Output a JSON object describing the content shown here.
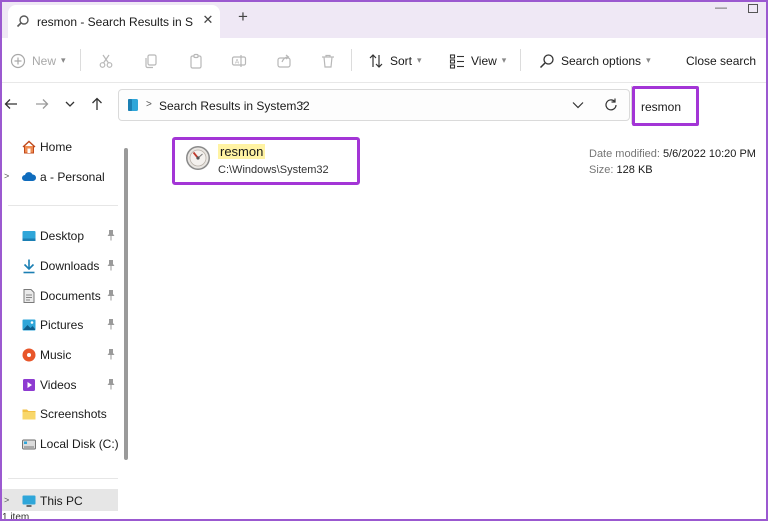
{
  "window": {
    "tab_title": "resmon - Search Results in Sys",
    "close_tab": "✕",
    "new_tab": "+",
    "minimize": "—"
  },
  "toolbar": {
    "new_label": "New",
    "sort_label": "Sort",
    "view_label": "View",
    "search_options_label": "Search options",
    "close_search_label": "Close search"
  },
  "address_bar": {
    "path_label": "Search Results in System32",
    "separator": ">"
  },
  "search": {
    "query": "resmon"
  },
  "sidebar": {
    "items": [
      {
        "label": "Home",
        "icon": "home-icon"
      },
      {
        "label": "a - Personal",
        "icon": "cloud-icon"
      },
      {
        "label": "Desktop",
        "icon": "desktop-icon",
        "pinned": true
      },
      {
        "label": "Downloads",
        "icon": "download-icon",
        "pinned": true
      },
      {
        "label": "Documents",
        "icon": "document-icon",
        "pinned": true
      },
      {
        "label": "Pictures",
        "icon": "picture-icon",
        "pinned": true
      },
      {
        "label": "Music",
        "icon": "music-icon",
        "pinned": true
      },
      {
        "label": "Videos",
        "icon": "video-icon",
        "pinned": true
      },
      {
        "label": "Screenshots",
        "icon": "folder-icon"
      },
      {
        "label": "Local Disk (C:)",
        "icon": "drive-icon"
      },
      {
        "label": "This PC",
        "icon": "pc-icon"
      }
    ]
  },
  "results": [
    {
      "name": "resmon",
      "path": "C:\\Windows\\System32",
      "date_label": "Date modified:",
      "date_value": "5/6/2022 10:20 PM",
      "size_label": "Size:",
      "size_value": "128 KB"
    }
  ],
  "status": {
    "item_count": "1 item"
  },
  "colors": {
    "highlight_border": "#a335d6",
    "match_highlight": "#fff3a3",
    "tabbar_bg": "#efe8f5"
  }
}
